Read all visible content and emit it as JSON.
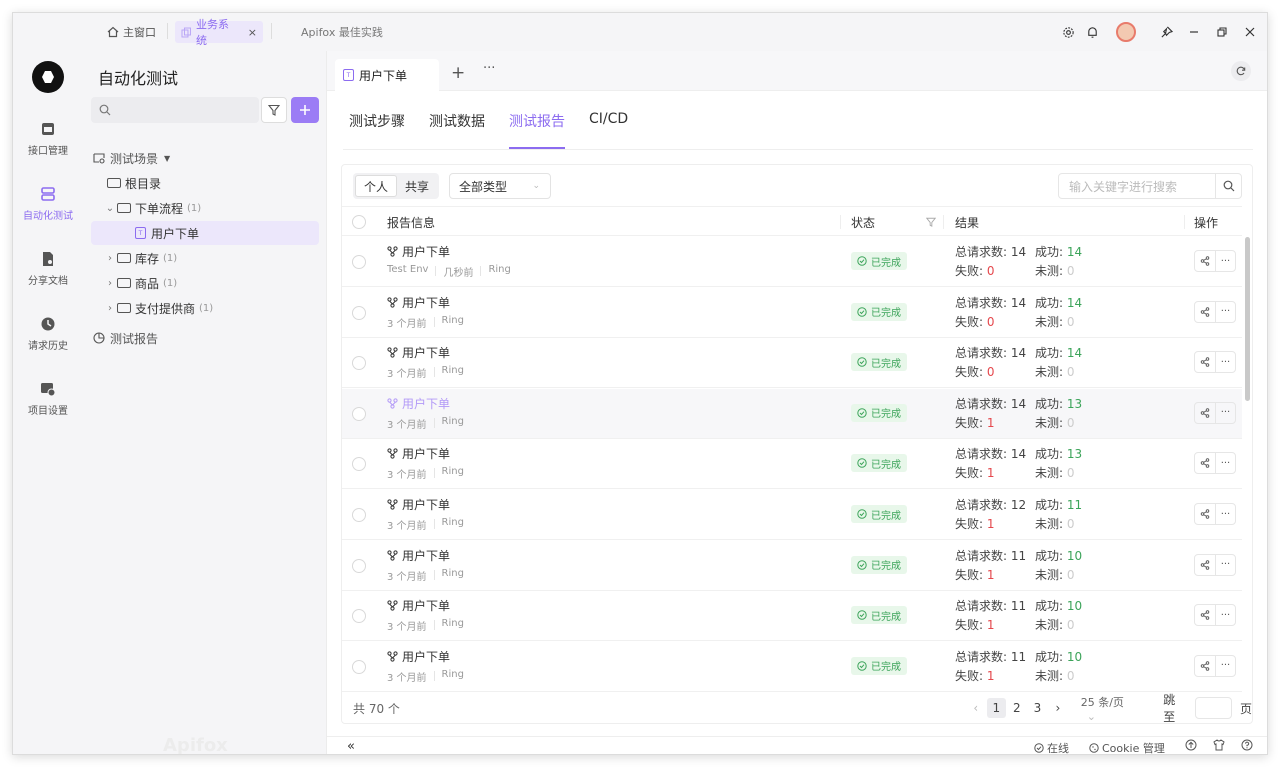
{
  "titlebar": {
    "tabs": [
      {
        "label": "主窗口",
        "icon": "home-icon"
      },
      {
        "label": "业务系统",
        "icon": "copy-icon",
        "close": "×"
      },
      {
        "label": "Apifox 最佳实践"
      }
    ]
  },
  "rail": {
    "items": [
      {
        "label": "接口管理",
        "icon": "api-icon"
      },
      {
        "label": "自动化测试",
        "icon": "automation-icon"
      },
      {
        "label": "分享文档",
        "icon": "doc-share-icon"
      },
      {
        "label": "请求历史",
        "icon": "history-icon"
      },
      {
        "label": "项目设置",
        "icon": "settings-icon"
      }
    ]
  },
  "tree": {
    "title": "自动化测试",
    "scenes_label": "测试场景",
    "nodes": [
      {
        "label": "根目录",
        "count": ""
      },
      {
        "label": "下单流程",
        "count": "(1)"
      },
      {
        "label": "用户下单",
        "count": ""
      },
      {
        "label": "库存",
        "count": "(1)"
      },
      {
        "label": "商品",
        "count": "(1)"
      },
      {
        "label": "支付提供商",
        "count": "(1)"
      }
    ],
    "reports_label": "测试报告",
    "watermark": "Apifox"
  },
  "main": {
    "doc_tab": "用户下单",
    "subtabs": [
      "测试步骤",
      "测试数据",
      "测试报告",
      "CI/CD"
    ],
    "seg": [
      "个人",
      "共享"
    ],
    "type_select": "全部类型",
    "keyword_placeholder": "输入关键字进行搜索",
    "headers": {
      "info": "报告信息",
      "status": "状态",
      "result": "结果",
      "ops": "操作"
    },
    "labels": {
      "total": "总请求数:",
      "success": "成功:",
      "fail": "失败:",
      "untested": "未测:",
      "status_done": "已完成"
    },
    "rows": [
      {
        "name": "用户下单",
        "env": "Test Env",
        "time": "几秒前",
        "user": "Ring",
        "total": "14",
        "success": "14",
        "fail": "0",
        "untested": "0"
      },
      {
        "name": "用户下单",
        "env": "",
        "time": "3 个月前",
        "user": "Ring",
        "total": "14",
        "success": "14",
        "fail": "0",
        "untested": "0"
      },
      {
        "name": "用户下单",
        "env": "",
        "time": "3 个月前",
        "user": "Ring",
        "total": "14",
        "success": "14",
        "fail": "0",
        "untested": "0"
      },
      {
        "name": "用户下单",
        "env": "",
        "time": "3 个月前",
        "user": "Ring",
        "total": "14",
        "success": "13",
        "fail": "1",
        "untested": "0"
      },
      {
        "name": "用户下单",
        "env": "",
        "time": "3 个月前",
        "user": "Ring",
        "total": "14",
        "success": "13",
        "fail": "1",
        "untested": "0"
      },
      {
        "name": "用户下单",
        "env": "",
        "time": "3 个月前",
        "user": "Ring",
        "total": "12",
        "success": "11",
        "fail": "1",
        "untested": "0"
      },
      {
        "name": "用户下单",
        "env": "",
        "time": "3 个月前",
        "user": "Ring",
        "total": "11",
        "success": "10",
        "fail": "1",
        "untested": "0"
      },
      {
        "name": "用户下单",
        "env": "",
        "time": "3 个月前",
        "user": "Ring",
        "total": "11",
        "success": "10",
        "fail": "1",
        "untested": "0"
      },
      {
        "name": "用户下单",
        "env": "",
        "time": "3 个月前",
        "user": "Ring",
        "total": "11",
        "success": "10",
        "fail": "1",
        "untested": "0"
      }
    ],
    "footer": {
      "total": "共 70 个",
      "pages": [
        "1",
        "2",
        "3"
      ],
      "page_size": "25 条/页",
      "jump_label": "跳至",
      "page_unit": "页"
    }
  },
  "statusbar": {
    "online": "在线",
    "cookie": "Cookie 管理"
  },
  "colors": {
    "accent": "#8c6cf0",
    "success": "#3ca45a",
    "danger": "#e5484d"
  }
}
